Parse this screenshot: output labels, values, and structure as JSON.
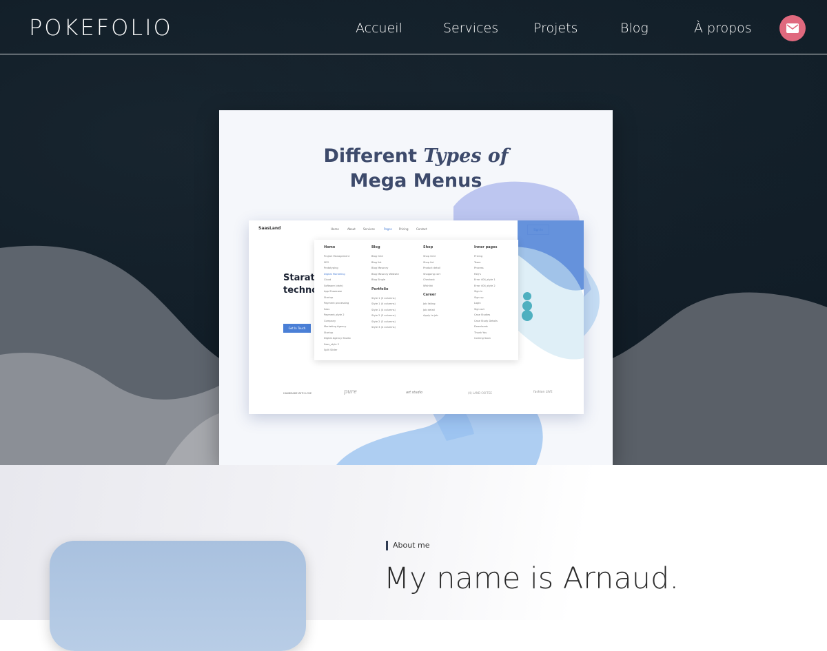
{
  "header": {
    "logo": "POKEFOLIO",
    "nav": [
      "Accueil",
      "Services",
      "Projets",
      "Blog",
      "À propos"
    ],
    "contact_icon": "mail-icon",
    "accent_color": "#e0697e"
  },
  "hero": {
    "showcase": {
      "title_line1_a": "Different",
      "title_line1_b": "Types of",
      "title_line2": "Mega Menus",
      "mock_brand": "SaasLand",
      "mock_nav": [
        "Home",
        "About",
        "Services",
        "Pages",
        "Pricing",
        "Contact"
      ],
      "mock_signin": "Sign In",
      "mock_heading_1": "Starato",
      "mock_heading_2": "techno",
      "mock_cta": "Get In Touch",
      "mega_menu": {
        "home": {
          "heading": "Home",
          "items": [
            "Project Management",
            "SEO",
            "Prototyping",
            "Digital Marketing",
            "Cloud",
            "Software (dark)",
            "App Showcase",
            "Startup",
            "Payment processing",
            "Sass",
            "Payment_style 2",
            "Company",
            "Marketing Agency",
            "Startup",
            "Digital Agency Studio",
            "Sass_style 2",
            "Split Slider"
          ]
        },
        "blog": {
          "heading": "Blog",
          "items": [
            "Blog Grid",
            "Blog list",
            "Blog Masonry",
            "Blog Masonry Website",
            "Blog Single"
          ]
        },
        "portfolio": {
          "heading": "Portfolio",
          "items": [
            "Style 1 (3 columns)",
            "Style 1 (4 columns)",
            "Style 1 (4 columns)",
            "Style 2 (3 columns)",
            "Style 2 (3 columns)",
            "Style 3 (4 columns)"
          ]
        },
        "shop": {
          "heading": "Shop",
          "items": [
            "Shop Grid",
            "Shop list",
            "Product detail",
            "Shopping cart",
            "Checkout",
            "Wishlist"
          ]
        },
        "career": {
          "heading": "Career",
          "items": [
            "Job listing",
            "Job detail",
            "Apply to job"
          ]
        },
        "inner": {
          "heading": "Inner pages",
          "items": [
            "Pricing",
            "Team",
            "Process",
            "FAQ's",
            "Error 404_style 1",
            "Error 404_style 2",
            "Sign in",
            "Sign up",
            "Login",
            "Sign out",
            "Case Studies",
            "Case Study Details",
            "Downloads",
            "Thank You",
            "Coming Soon"
          ]
        }
      },
      "logos": [
        "HANDMADE WITH LOVE",
        "pure",
        "art studio",
        "(4) LAND COFFEE",
        "fashion LIVE"
      ]
    }
  },
  "about": {
    "tag": "About me",
    "title": "My name is Arnaud."
  }
}
